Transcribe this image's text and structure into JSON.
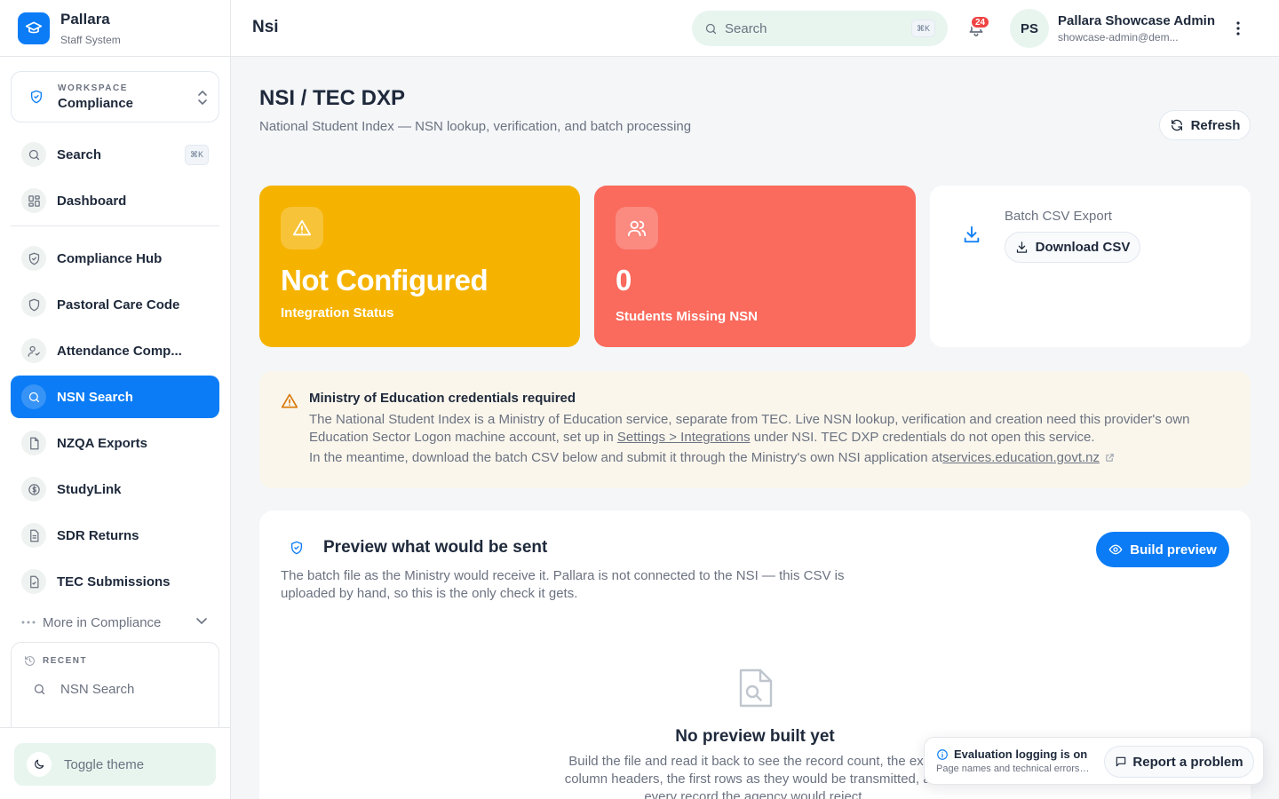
{
  "brand": {
    "name": "Pallara",
    "subtitle": "Staff System"
  },
  "workspace": {
    "label": "WORKSPACE",
    "value": "Compliance"
  },
  "sidebar": {
    "search": {
      "label": "Search",
      "shortcut": "⌘K"
    },
    "items": [
      {
        "label": "Dashboard",
        "icon": "grid-icon"
      },
      {
        "label": "Compliance Hub",
        "icon": "shield-check-icon"
      },
      {
        "label": "Pastoral Care Code",
        "icon": "shield-icon"
      },
      {
        "label": "Attendance Comp...",
        "icon": "user-check-icon"
      },
      {
        "label": "NSN Search",
        "icon": "search-icon",
        "active": true
      },
      {
        "label": "NZQA Exports",
        "icon": "file-icon"
      },
      {
        "label": "StudyLink",
        "icon": "dollar-icon"
      },
      {
        "label": "SDR Returns",
        "icon": "document-icon"
      },
      {
        "label": "TEC Submissions",
        "icon": "file-check-icon"
      }
    ],
    "more_label": "More in Compliance",
    "recent": {
      "title": "RECENT",
      "items": [
        {
          "label": "NSN Search"
        }
      ]
    },
    "toggle_theme": "Toggle theme"
  },
  "header": {
    "crumb": "Nsi",
    "search_placeholder": "Search",
    "search_shortcut": "⌘K",
    "notification_count": "24",
    "user": {
      "initials": "PS",
      "name": "Pallara Showcase Admin",
      "email": "showcase-admin@dem..."
    }
  },
  "page": {
    "title": "NSI / TEC DXP",
    "subtitle": "National Student Index — NSN lookup, verification, and batch processing",
    "refresh_label": "Refresh"
  },
  "cards": {
    "status": {
      "value": "Not Configured",
      "label": "Integration Status"
    },
    "missing": {
      "value": "0",
      "label": "Students Missing NSN"
    },
    "export": {
      "label": "Batch CSV Export",
      "button": "Download CSV"
    }
  },
  "alert": {
    "title": "Ministry of Education credentials required",
    "body_before": "The National Student Index is a Ministry of Education service, separate from TEC. Live NSN lookup, verification and creation need this provider's own Education Sector Logon machine account, set up in ",
    "body_link": "Settings > Integrations",
    "body_after": " under NSI. TEC DXP credentials do not open this service.",
    "line2_before": "In the meantime, download the batch CSV below and submit it through the Ministry's own NSI application at ",
    "line2_link": "services.education.govt.nz"
  },
  "preview": {
    "title": "Preview what would be sent",
    "description": "The batch file as the Ministry would receive it. Pallara is not connected to the NSI — this CSV is uploaded by hand, so this is the only check it gets.",
    "build_button": "Build preview",
    "empty_title": "No preview built yet",
    "empty_description": "Build the file and read it back to see the record count, the exact column headers, the first rows as they would be transmitted, and every record the agency would reject."
  },
  "toast": {
    "title": "Evaluation logging is on",
    "subtitle": "Page names and technical errors are recorded",
    "button": "Report a problem"
  },
  "colors": {
    "accent": "#0b7cf5",
    "warning": "#f5b300",
    "danger": "#fa6a5d",
    "mint": "#e8f5ef"
  }
}
